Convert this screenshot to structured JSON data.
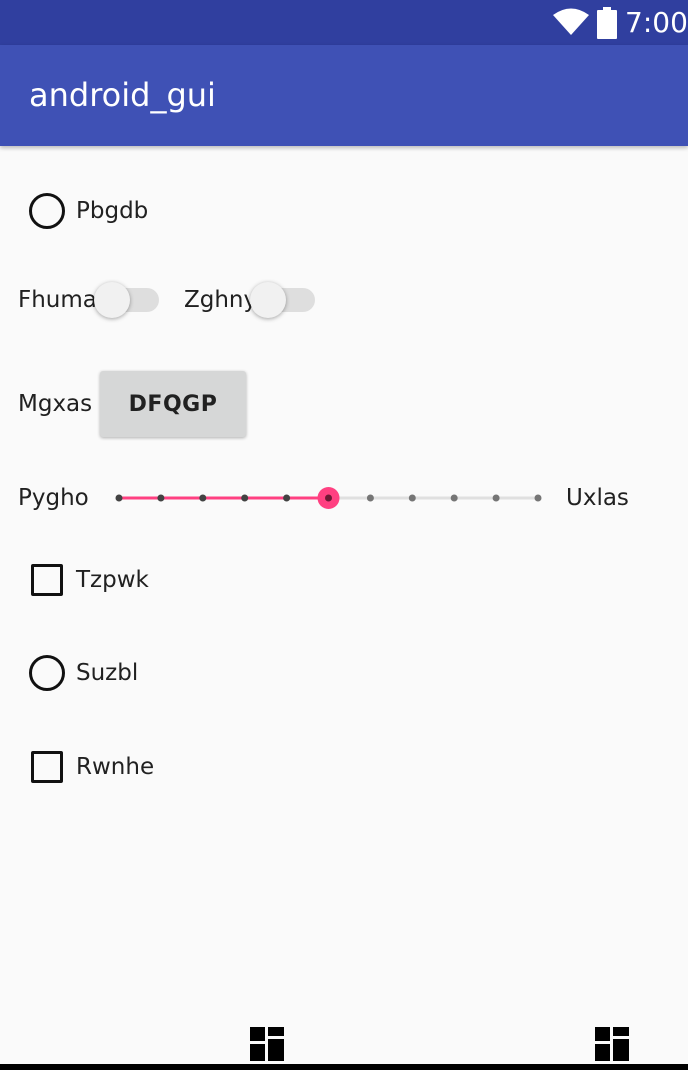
{
  "status_bar": {
    "time": "7:00",
    "icons": [
      "wifi-icon",
      "battery-icon"
    ],
    "background": "#303f9f"
  },
  "app_bar": {
    "title": "android_gui",
    "background": "#3f51b5"
  },
  "controls": {
    "radio_1": {
      "label": "Pbgdb",
      "checked": false
    },
    "switch_1": {
      "label": "Fhuma",
      "on": false
    },
    "switch_2": {
      "label": "Zghny",
      "on": false
    },
    "button_row": {
      "label": "Mgxas",
      "button_text": "DFQGP"
    },
    "seekbar": {
      "left_label": "Pygho",
      "right_label": "Uxlas",
      "ticks": 11,
      "value": 5,
      "max": 10,
      "accent": "#ff4081"
    },
    "checkbox_1": {
      "label": "Tzpwk",
      "checked": false
    },
    "radio_2": {
      "label": "Suzbl",
      "checked": false
    },
    "checkbox_2": {
      "label": "Rwnhe",
      "checked": false
    }
  },
  "bottom": {
    "icons": [
      "grid-icon",
      "grid-icon"
    ]
  }
}
